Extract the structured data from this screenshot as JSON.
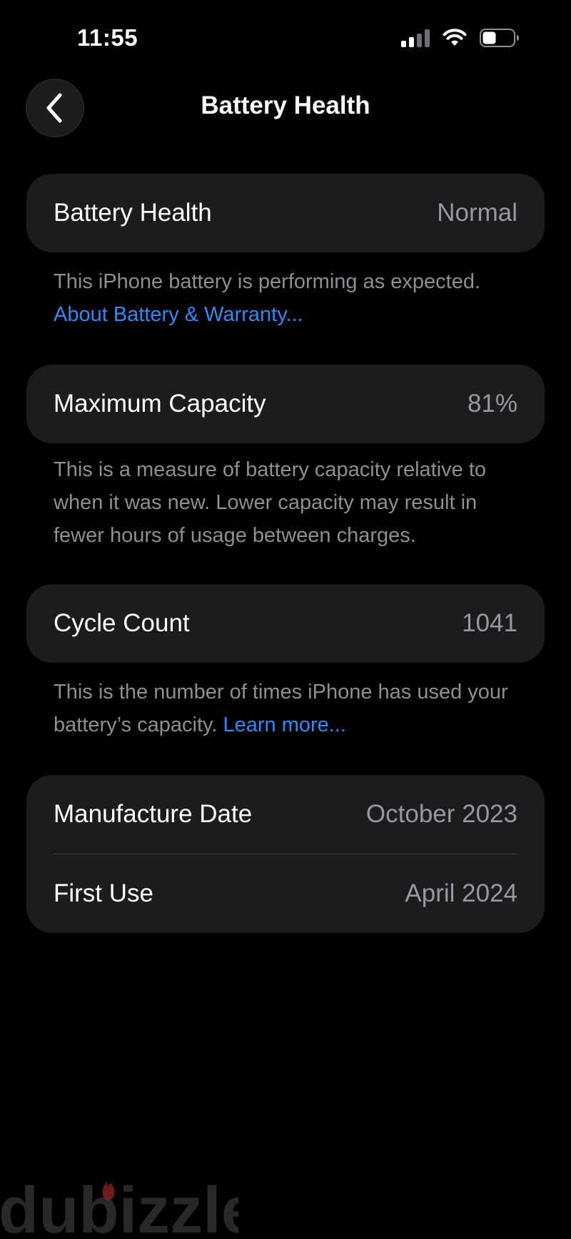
{
  "status_bar": {
    "time": "11:55",
    "icons": [
      "cellular-signal-icon",
      "wifi-icon",
      "battery-icon"
    ]
  },
  "nav": {
    "back_icon": "chevron-left-icon",
    "title": "Battery Health"
  },
  "battery_health": {
    "label": "Battery Health",
    "value": "Normal",
    "footnote_text": "This iPhone battery is performing as expected.",
    "footnote_link": "About Battery & Warranty..."
  },
  "maximum_capacity": {
    "label": "Maximum Capacity",
    "value": "81%",
    "footnote_text": "This is a measure of battery capacity relative to when it was new. Lower capacity may result in fewer hours of usage between charges."
  },
  "cycle_count": {
    "label": "Cycle Count",
    "value": "1041",
    "footnote_text": "This is the number of times iPhone has used your battery’s capacity.",
    "footnote_link": "Learn more..."
  },
  "dates": {
    "manufacture_label": "Manufacture Date",
    "manufacture_value": "October 2023",
    "first_use_label": "First Use",
    "first_use_value": "April 2024"
  },
  "watermark": {
    "text": "dubizzle"
  },
  "colors": {
    "background": "#000000",
    "card": "#1c1c1e",
    "secondary_text": "#98989d",
    "link": "#2f8bf7"
  }
}
